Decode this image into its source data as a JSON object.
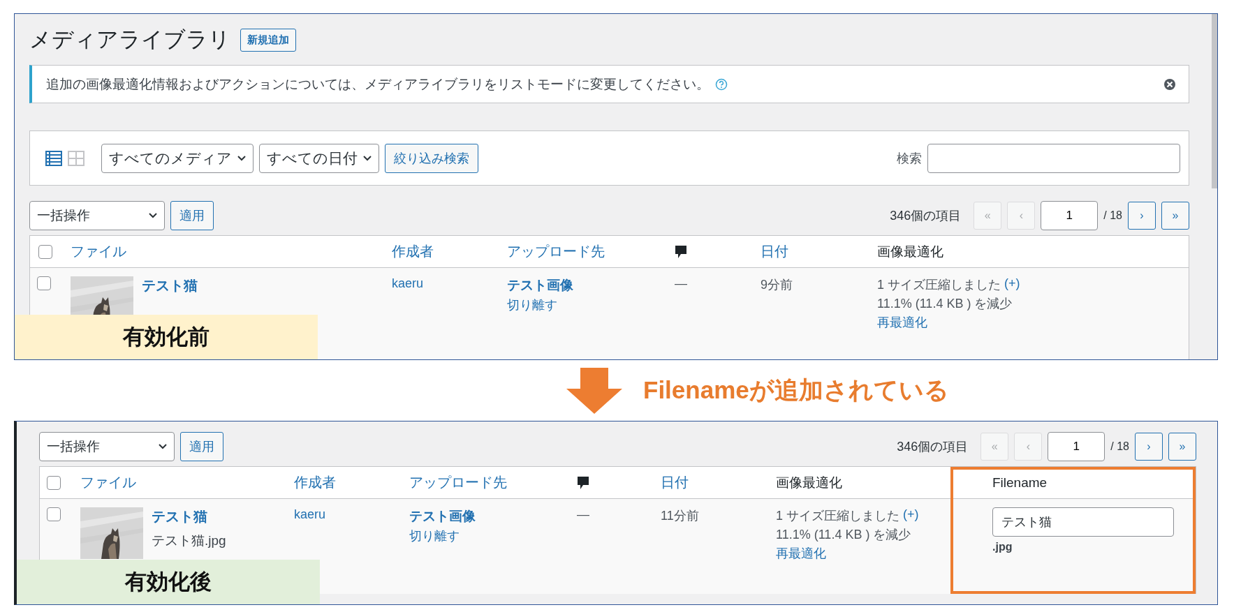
{
  "panels": [
    {
      "kind": "before",
      "label": "有効化前",
      "page_title": "メディアライブラリ",
      "add_new_button": "新規追加",
      "notice": "追加の画像最適化情報およびアクションについては、メディアライブラリをリストモードに変更してください。",
      "filter_bar": {
        "view_modes": [
          {
            "kind": "list",
            "selected": true
          },
          {
            "kind": "grid",
            "selected": false
          }
        ],
        "media_type": "すべてのメディア",
        "date": "すべての日付",
        "filter_button": "絞り込み検索",
        "search_label": "検索"
      },
      "bulk_actions": "一括操作",
      "apply_button": "適用",
      "item_count": "346個の項目",
      "pagination": [
        {
          "kind": "button",
          "label": "«",
          "disabled": true
        },
        {
          "kind": "button",
          "label": "‹",
          "disabled": true
        },
        {
          "kind": "page-input",
          "value": "1"
        },
        {
          "kind": "text",
          "label": "/ 18"
        },
        {
          "kind": "button",
          "label": "›",
          "disabled": false
        },
        {
          "kind": "button",
          "label": "»",
          "disabled": false
        }
      ],
      "columns": [
        {
          "kind": "checkbox",
          "checked": false
        },
        {
          "kind": "link",
          "label": "ファイル"
        },
        {
          "kind": "link",
          "label": "作成者"
        },
        {
          "kind": "link",
          "label": "アップロード先"
        },
        {
          "kind": "icon"
        },
        {
          "kind": "link",
          "label": "日付"
        },
        {
          "kind": "plain",
          "label": "画像最適化"
        }
      ],
      "row": [
        {
          "kind": "checkbox",
          "checked": false
        },
        {
          "kind": "file",
          "title": "テスト猫"
        },
        {
          "kind": "link",
          "text": "kaeru"
        },
        {
          "kind": "attached",
          "title": "テスト画像",
          "action": "切り離す"
        },
        {
          "kind": "text",
          "text": "—"
        },
        {
          "kind": "text",
          "text": "9分前"
        },
        {
          "kind": "optimization",
          "summary": "1 サイズ圧縮しました",
          "more": "(+)",
          "saving": "11.1% (11.4 KB ) を減少",
          "action": "再最適化"
        }
      ]
    },
    {
      "kind": "after",
      "label": "有効化後",
      "bulk_actions": "一括操作",
      "apply_button": "適用",
      "item_count": "346個の項目",
      "pagination": [
        {
          "kind": "button",
          "label": "«",
          "disabled": true
        },
        {
          "kind": "button",
          "label": "‹",
          "disabled": true
        },
        {
          "kind": "page-input",
          "value": "1"
        },
        {
          "kind": "text",
          "label": "/ 18"
        },
        {
          "kind": "button",
          "label": "›",
          "disabled": false
        },
        {
          "kind": "button",
          "label": "»",
          "disabled": false
        }
      ],
      "columns": [
        {
          "kind": "checkbox",
          "checked": false
        },
        {
          "kind": "link",
          "label": "ファイル"
        },
        {
          "kind": "link",
          "label": "作成者"
        },
        {
          "kind": "link",
          "label": "アップロード先"
        },
        {
          "kind": "icon"
        },
        {
          "kind": "link",
          "label": "日付"
        },
        {
          "kind": "plain",
          "label": "画像最適化"
        },
        {
          "kind": "plain",
          "label": "Filename",
          "highlighted": true
        }
      ],
      "row": [
        {
          "kind": "checkbox",
          "checked": false
        },
        {
          "kind": "file",
          "title": "テスト猫",
          "filename": "テスト猫.jpg"
        },
        {
          "kind": "link",
          "text": "kaeru"
        },
        {
          "kind": "attached",
          "title": "テスト画像",
          "action": "切り離す"
        },
        {
          "kind": "text",
          "text": "—"
        },
        {
          "kind": "text",
          "text": "11分前"
        },
        {
          "kind": "optimization",
          "summary": "1 サイズ圧縮しました",
          "more": "(+)",
          "saving": "11.1% (11.4 KB ) を減少",
          "action": "再最適化"
        },
        {
          "kind": "filename-field",
          "value": "テスト猫",
          "extension": ".jpg"
        }
      ]
    }
  ],
  "annotation": "Filenameが追加されている"
}
